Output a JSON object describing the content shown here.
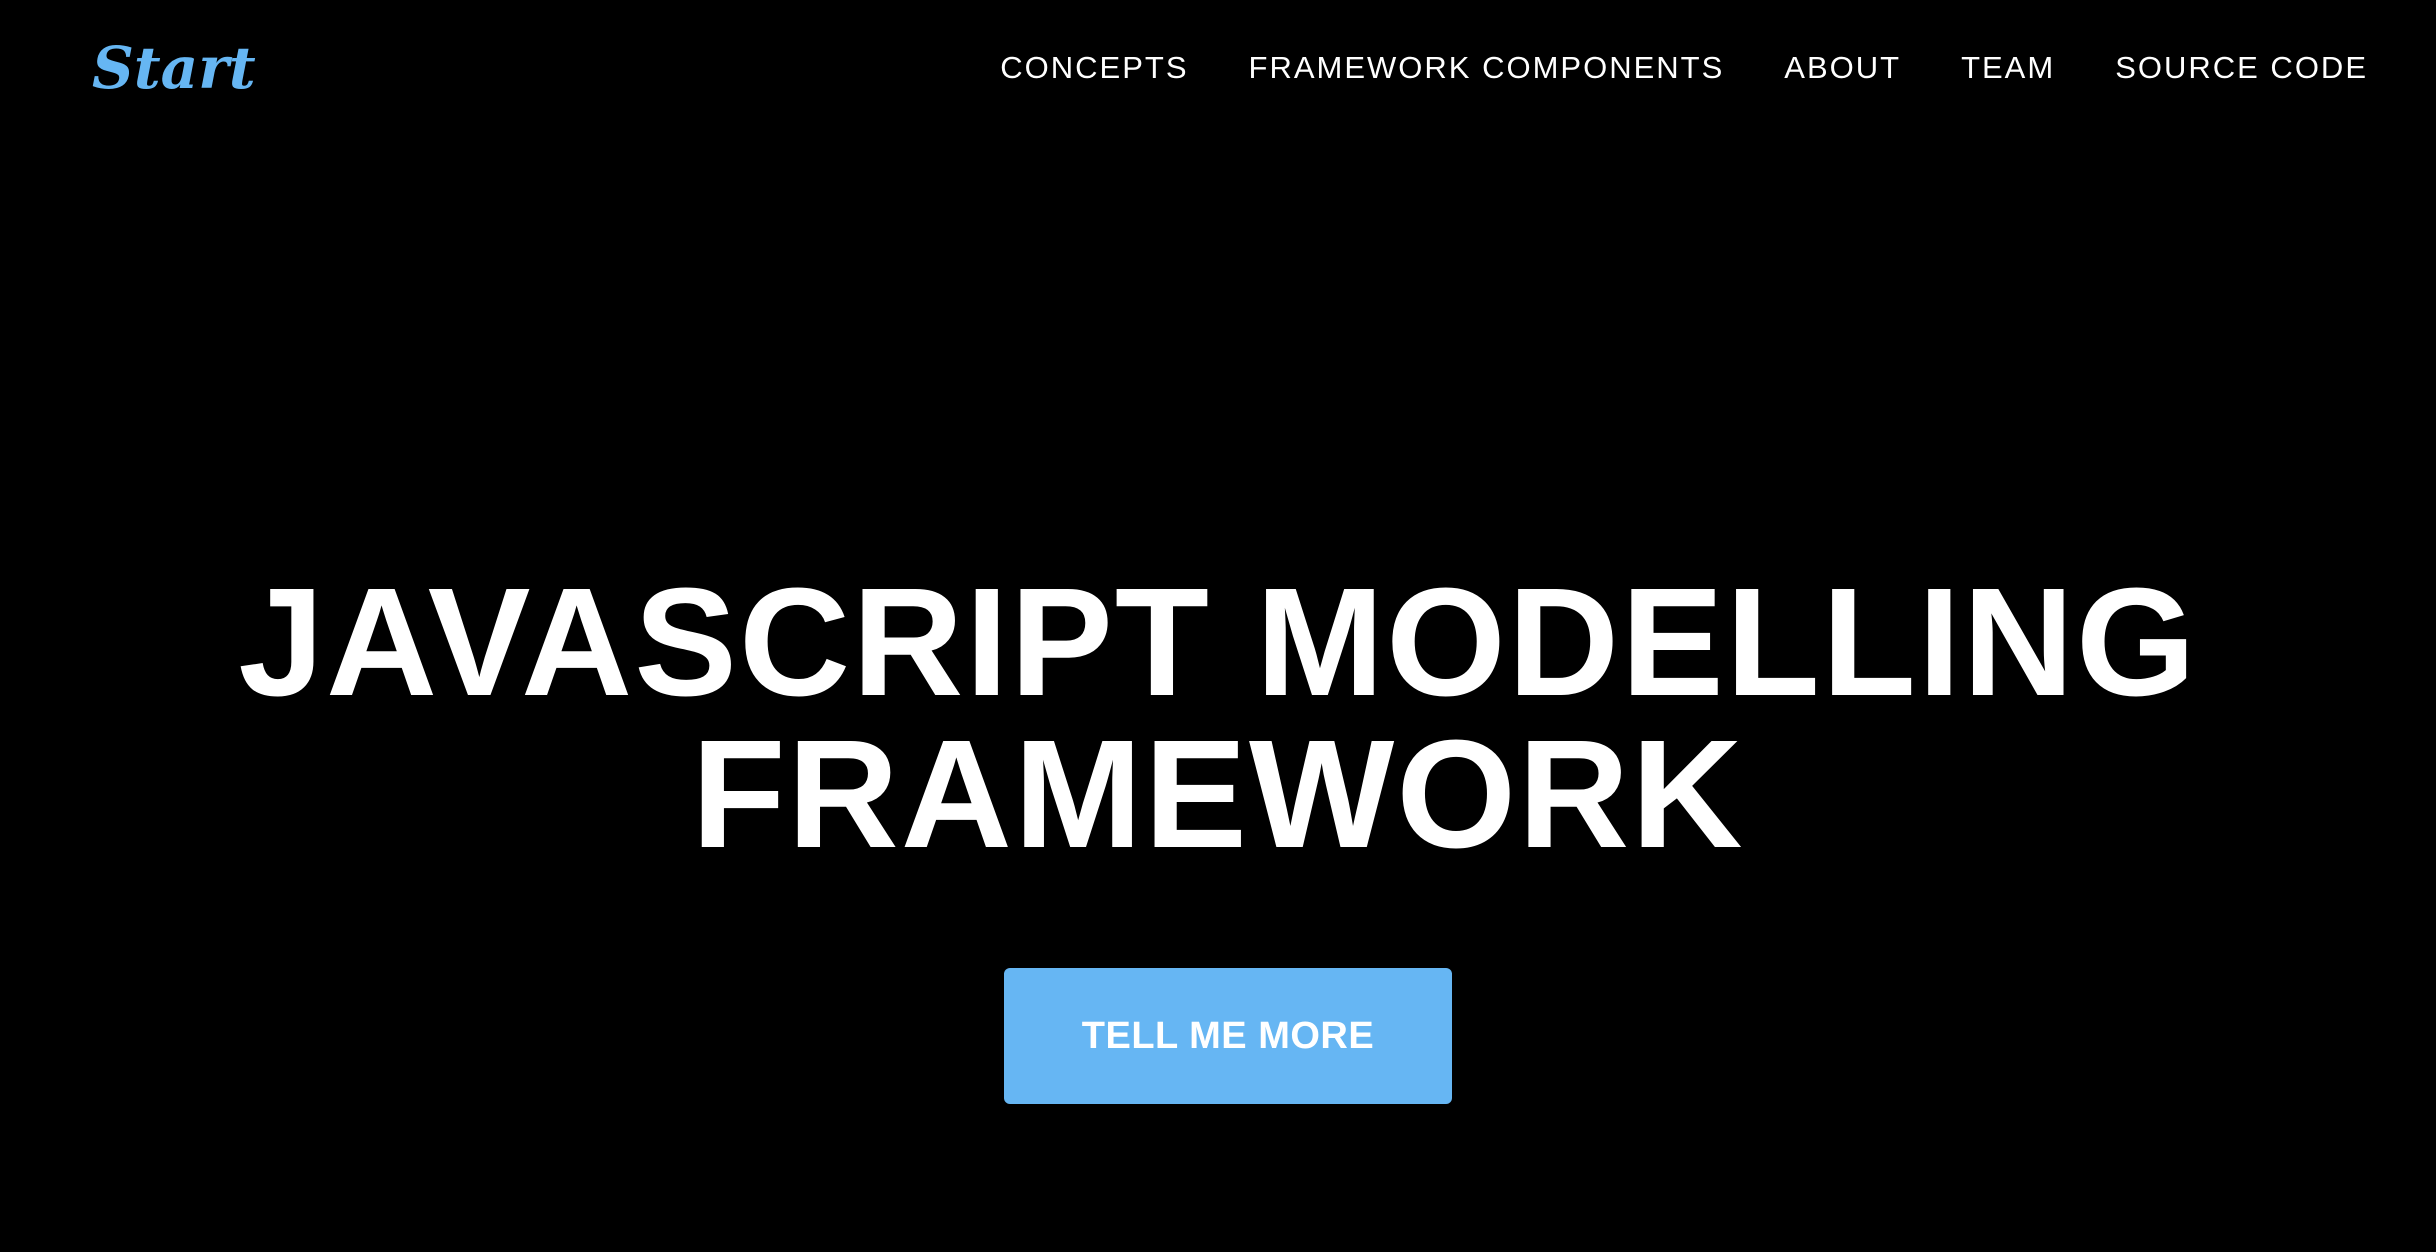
{
  "brand": {
    "name": "Start",
    "color": "#66b6f3"
  },
  "nav": {
    "items": [
      {
        "label": "CONCEPTS"
      },
      {
        "label": "FRAMEWORK COMPONENTS"
      },
      {
        "label": "ABOUT"
      },
      {
        "label": "TEAM"
      },
      {
        "label": "SOURCE CODE"
      }
    ]
  },
  "hero": {
    "title_lines": [
      "JAVASCRIPT MODELLING",
      "FRAMEWORK"
    ],
    "cta_label": "TELL ME MORE",
    "cta_color": "#66b6f3",
    "background": "#000000"
  }
}
